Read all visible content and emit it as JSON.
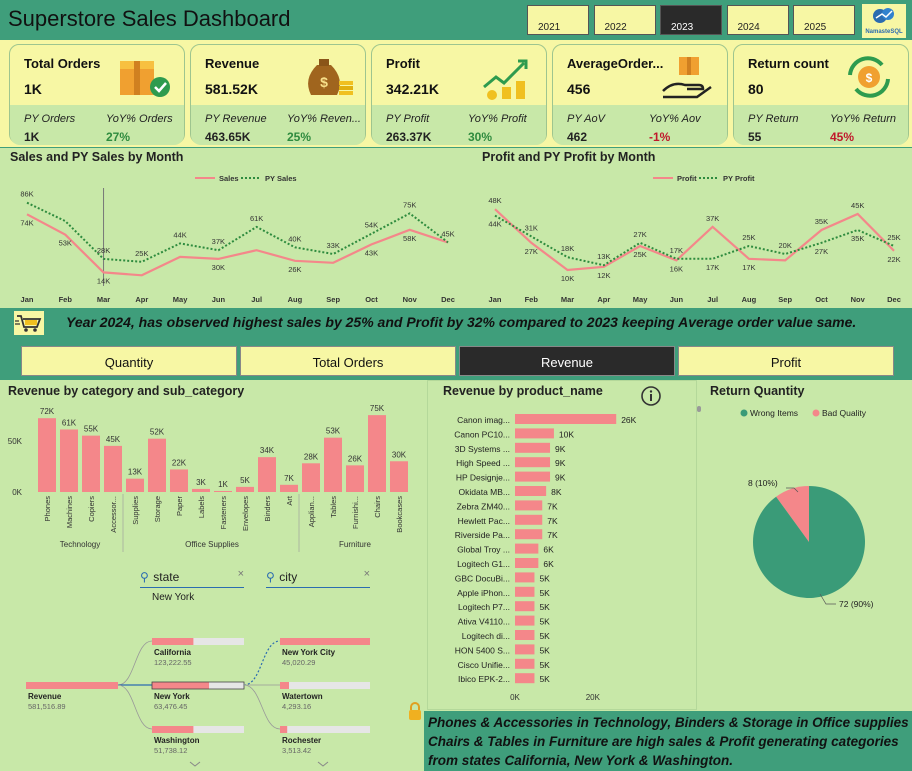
{
  "header": {
    "title": "Superstore Sales Dashboard",
    "years": [
      "2021",
      "2022",
      "2023",
      "2024",
      "2025"
    ],
    "selected_year": "2023",
    "logo_text": "NamasteSQL"
  },
  "kpis": [
    {
      "label": "Total Orders",
      "value": "1K",
      "py_label": "PY Orders",
      "py_value": "1K",
      "yoy_label": "YoY% Orders",
      "yoy_value": "27%",
      "yoy_color": "#2e8b3e",
      "icon": "box-check-icon"
    },
    {
      "label": "Revenue",
      "value": "581.52K",
      "py_label": "PY Revenue",
      "py_value": "463.65K",
      "yoy_label": "YoY% Reven...",
      "yoy_value": "25%",
      "yoy_color": "#2e8b3e",
      "icon": "money-bag-icon"
    },
    {
      "label": "Profit",
      "value": "342.21K",
      "py_label": "PY Profit",
      "py_value": "263.37K",
      "yoy_label": "YoY% Profit",
      "yoy_value": "30%",
      "yoy_color": "#2e8b3e",
      "icon": "growth-coins-icon"
    },
    {
      "label": "AverageOrder...",
      "value": "456",
      "py_label": "PY AoV",
      "py_value": "462",
      "yoy_label": "YoY% Aov",
      "yoy_value": "-1%",
      "yoy_color": "#c0182b",
      "icon": "hand-box-icon"
    },
    {
      "label": "Return count",
      "value": "80",
      "py_label": "PY Return",
      "py_value": "55",
      "yoy_label": "YoY% Return",
      "yoy_value": "45%",
      "yoy_color": "#c0182b",
      "icon": "refund-icon"
    }
  ],
  "colors": {
    "accent": "#3f9e7b",
    "panel": "#c8e8a8",
    "card": "#f7f7a4",
    "series": "#f4878a",
    "py": "#2e8b3e",
    "green_pie": "#3a9b78"
  },
  "chart_data": [
    {
      "type": "line",
      "title": "Sales and PY Sales by Month",
      "categories": [
        "Jan",
        "Feb",
        "Mar",
        "Apr",
        "May",
        "Jun",
        "Jul",
        "Aug",
        "Sep",
        "Oct",
        "Nov",
        "Dec"
      ],
      "series": [
        {
          "name": "Sales",
          "values": [
            74,
            53,
            14,
            11,
            30,
            28,
            37,
            26,
            24,
            43,
            58,
            45
          ],
          "labels": [
            "74K",
            "53K",
            "14K",
            "",
            "",
            "30K",
            "",
            "26K",
            "",
            "43K",
            "58K",
            ""
          ]
        },
        {
          "name": "PY Sales",
          "values": [
            86,
            67,
            28,
            25,
            44,
            37,
            61,
            40,
            33,
            54,
            75,
            45
          ],
          "labels": [
            "86K",
            "",
            "28K",
            "25K",
            "44K",
            "37K",
            "61K",
            "40K",
            "33K",
            "54K",
            "75K",
            "45K"
          ]
        }
      ],
      "ylim": [
        0,
        95
      ]
    },
    {
      "type": "line",
      "title": "Profit and PY Profit by Month",
      "categories": [
        "Jan",
        "Feb",
        "Mar",
        "Apr",
        "May",
        "Jun",
        "Jul",
        "Aug",
        "Sep",
        "Oct",
        "Nov",
        "Dec"
      ],
      "series": [
        {
          "name": "Profit",
          "values": [
            48,
            27,
            10,
            12,
            25,
            16,
            37,
            17,
            16,
            35,
            45,
            22
          ],
          "labels": [
            "48K",
            "27K",
            "10K",
            "12K",
            "25K",
            "16K",
            "37K",
            "17K",
            "",
            "35K",
            "45K",
            "22K"
          ]
        },
        {
          "name": "PY Profit",
          "values": [
            44,
            31,
            18,
            13,
            27,
            17,
            17,
            25,
            20,
            27,
            35,
            25
          ],
          "labels": [
            "44K",
            "31K",
            "18K",
            "13K",
            "27K",
            "17K",
            "17K",
            "25K",
            "20K",
            "27K",
            "35K",
            "25K"
          ]
        }
      ],
      "ylim": [
        0,
        55
      ]
    },
    {
      "type": "bar",
      "title": "Revenue by category and sub_category",
      "categories": [
        "Phones",
        "Machines",
        "Copiers",
        "Accessor...",
        "Supplies",
        "Storage",
        "Paper",
        "Labels",
        "Fasteners",
        "Envelopes",
        "Binders",
        "Art",
        "Applian...",
        "Tables",
        "Furnishi...",
        "Chairs",
        "Bookcases"
      ],
      "values": [
        72,
        61,
        55,
        45,
        13,
        52,
        22,
        3,
        1,
        5,
        34,
        7,
        28,
        53,
        26,
        75,
        30
      ],
      "value_labels": [
        "72K",
        "61K",
        "55K",
        "45K",
        "13K",
        "52K",
        "22K",
        "3K",
        "1K",
        "5K",
        "34K",
        "7K",
        "28K",
        "53K",
        "26K",
        "75K",
        "30K"
      ],
      "groups": [
        {
          "name": "Technology",
          "count": 4
        },
        {
          "name": "Office Supplies",
          "count": 8
        },
        {
          "name": "Furniture",
          "count": 5
        }
      ],
      "yticks": [
        "50K",
        "0K"
      ],
      "ylim": [
        0,
        80
      ]
    },
    {
      "type": "bar",
      "title": "Revenue by product_name",
      "categories": [
        "Canon imag...",
        "Canon PC10...",
        "3D Systems ...",
        "High Speed ...",
        "HP Designje...",
        "Okidata MB...",
        "Zebra ZM40...",
        "Hewlett Pac...",
        "Riverside Pa...",
        "Global Troy ...",
        "Logitech G1...",
        "GBC DocuBi...",
        "Apple iPhon...",
        "Logitech P7...",
        "Ativa V4110...",
        "Logitech di...",
        "HON 5400 S...",
        "Cisco Unifie...",
        "Ibico EPK-2..."
      ],
      "values": [
        26,
        10,
        9,
        9,
        9,
        8,
        7,
        7,
        7,
        6,
        6,
        5,
        5,
        5,
        5,
        5,
        5,
        5,
        5
      ],
      "value_labels": [
        "26K",
        "10K",
        "9K",
        "9K",
        "9K",
        "8K",
        "7K",
        "7K",
        "7K",
        "6K",
        "6K",
        "5K",
        "5K",
        "5K",
        "5K",
        "5K",
        "5K",
        "5K",
        "5K"
      ],
      "xticks": [
        "0K",
        "20K"
      ],
      "xlim": [
        0,
        28
      ]
    },
    {
      "type": "pie",
      "title": "Return Quantity",
      "labels": [
        "Wrong Items",
        "Bad Quality"
      ],
      "values": [
        72,
        8
      ],
      "slice_labels": [
        "72 (90%)",
        "8 (10%)"
      ]
    }
  ],
  "insights": {
    "line1": "Year 2024, has observed highest sales by 25% and Profit by 32% compared to 2023 keeping Average order value same.",
    "line2": "Phones & Accessories in Technology, Binders & Storage in Office supplies Chairs & Tables in Furniture are high sales & Profit generating categories from states California, New York & Washington."
  },
  "tabs": [
    "Quantity",
    "Total Orders",
    "Revenue",
    "Profit"
  ],
  "selected_tab": "Revenue",
  "slicers": {
    "state": {
      "label": "state",
      "value": "New York"
    },
    "city": {
      "label": "city",
      "value": ""
    }
  },
  "decomp": {
    "root": {
      "label": "Revenue",
      "value": "581,516.89"
    },
    "states": [
      {
        "label": "California",
        "value": "123,222.55",
        "fill": 0.45
      },
      {
        "label": "New York",
        "value": "63,476.45",
        "fill": 0.62
      },
      {
        "label": "Washington",
        "value": "51,738.12",
        "fill": 0.45
      }
    ],
    "cities": [
      {
        "label": "New York City",
        "value": "45,020.29",
        "fill": 1.0
      },
      {
        "label": "Watertown",
        "value": "4,293.16",
        "fill": 0.1
      },
      {
        "label": "Rochester",
        "value": "3,513.42",
        "fill": 0.08
      }
    ]
  }
}
